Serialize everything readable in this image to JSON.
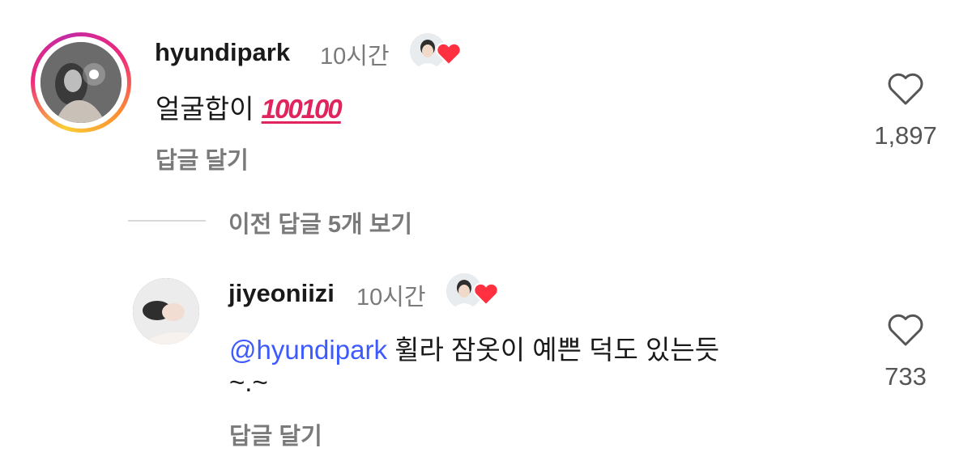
{
  "comments": [
    {
      "username": "hyundipark",
      "time": "10시간",
      "text": "얼굴합이",
      "emoji": "💯💯",
      "emoji_label": "100100",
      "reply_label": "답글 달기",
      "likes": "1,897",
      "avatar_icon": "profile-photo",
      "liked_by_creator_icon": "creator-heart-badge"
    },
    {
      "username": "jiyeoniizi",
      "time": "10시간",
      "mention": "@hyundipark",
      "text_line1": "휠라 잠옷이 예쁜 덕도 있는듯",
      "text_line2": "~.~",
      "reply_label": "답글 달기",
      "likes": "733",
      "avatar_icon": "profile-photo",
      "liked_by_creator_icon": "creator-heart-badge"
    }
  ],
  "view_previous_replies": "이전 답글 5개 보기",
  "colors": {
    "heart_red": "#ff3040",
    "mention_blue": "#3d5afe",
    "muted_gray": "#7a7a7a"
  }
}
